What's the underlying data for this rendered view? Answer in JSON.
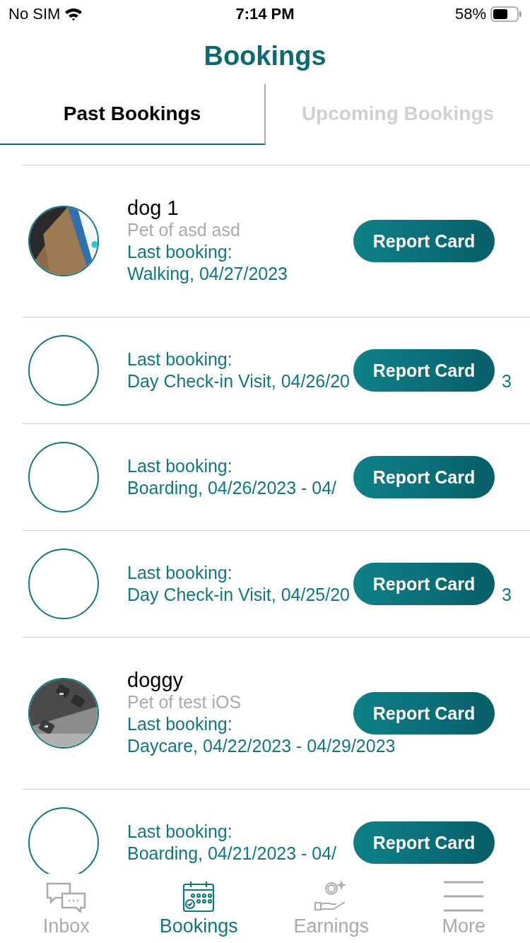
{
  "status_bar": {
    "carrier": "No SIM",
    "time": "7:14 PM",
    "battery": "58%"
  },
  "title": "Bookings",
  "tabs": [
    {
      "label": "Past Bookings",
      "selected": true
    },
    {
      "label": "Upcoming Bookings",
      "selected": false
    }
  ],
  "bookings": [
    {
      "photo": true,
      "name": "dog 1",
      "owner": "Pet of asd asd",
      "label": "Last booking:",
      "date": "Walking, 04/27/2023",
      "button": "Report Card"
    },
    {
      "photo": false,
      "label": "Last booking:",
      "date": "Day Check-in Visit, 04/26/20",
      "date_tail": "3",
      "button": "Report Card"
    },
    {
      "photo": false,
      "label": "Last booking:",
      "date": "Boarding, 04/26/2023 - 04/",
      "button": "Report Card"
    },
    {
      "photo": false,
      "label": "Last booking:",
      "date": "Day Check-in Visit, 04/25/20",
      "date_tail": "3",
      "button": "Report Card"
    },
    {
      "photo": true,
      "name": "doggy",
      "owner": "Pet of test iOS",
      "label": "Last booking:",
      "date": "Daycare, 04/22/2023 - 04/29/2023",
      "button": "Report Card"
    },
    {
      "photo": false,
      "label": "Last booking:",
      "date": "Boarding, 04/21/2023 - 04/",
      "button": "Report Card"
    }
  ],
  "tab_bar": [
    {
      "label": "Inbox",
      "selected": false
    },
    {
      "label": "Bookings",
      "selected": true
    },
    {
      "label": "Earnings",
      "selected": false
    },
    {
      "label": "More",
      "selected": false
    }
  ]
}
